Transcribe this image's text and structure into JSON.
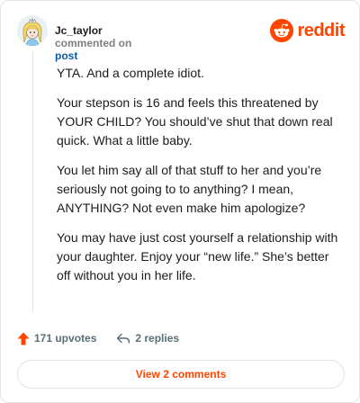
{
  "header": {
    "username": "Jc_taylor",
    "action_text": "commented on",
    "target_text": "post",
    "brand_text": "reddit"
  },
  "comment": {
    "paragraphs": [
      "YTA. And a complete idiot.",
      "Your stepson is 16 and feels this threatened by YOUR CHILD? You should’ve shut that down real quick. What a little baby.",
      "You let him say all of that stuff to her and you’re seriously not going to to anything? I mean, ANYTHING? Not even make him apologize?",
      "You may have just cost yourself a relationship with your daughter. Enjoy your “new life.” She’s better off without you in her life."
    ]
  },
  "footer": {
    "upvotes_label": "171 upvotes",
    "replies_label": "2 replies",
    "view_button_label": "View 2 comments"
  },
  "icons": {
    "avatar": "avatar",
    "brand": "reddit-icon",
    "upvote": "upvote-arrow-icon",
    "reply": "reply-icon"
  },
  "colors": {
    "brand": "#ff4500",
    "link": "#0b5aa8",
    "muted": "#7c8084",
    "border": "#e0e3e6"
  }
}
